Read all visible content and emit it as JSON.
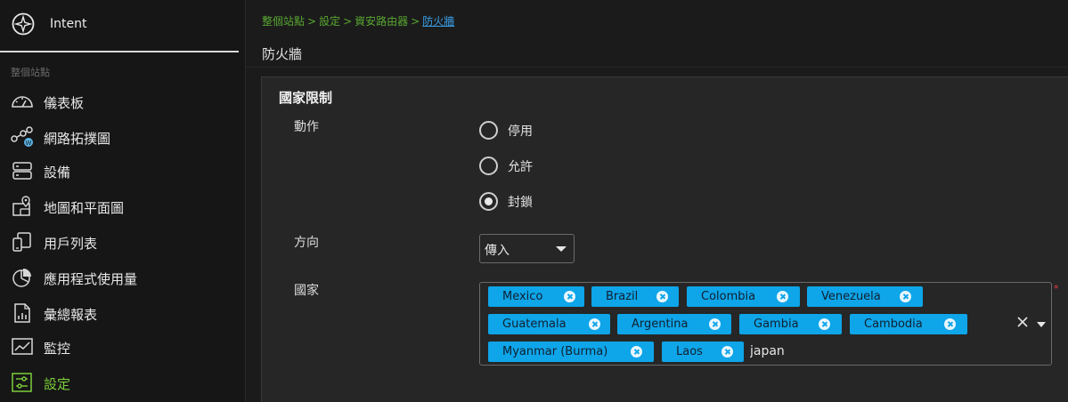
{
  "sidebar": {
    "brand_label": "Intent",
    "section_label": "整個站點",
    "items": [
      {
        "label": "儀表板",
        "icon": "dashboard-icon"
      },
      {
        "label": "網路拓撲圖",
        "icon": "topology-icon"
      },
      {
        "label": "設備",
        "icon": "devices-icon"
      },
      {
        "label": "地圖和平面圖",
        "icon": "map-icon"
      },
      {
        "label": "用戶列表",
        "icon": "clients-icon"
      },
      {
        "label": "應用程式使用量",
        "icon": "pie-chart-icon"
      },
      {
        "label": "彙總報表",
        "icon": "report-icon"
      },
      {
        "label": "監控",
        "icon": "monitor-icon"
      },
      {
        "label": "設定",
        "icon": "settings-icon",
        "active": true
      }
    ]
  },
  "breadcrumb": {
    "items": [
      "整個站點",
      "設定",
      "資安路由器"
    ],
    "separator": ">",
    "current": "防火牆"
  },
  "page": {
    "title": "防火牆"
  },
  "panel": {
    "title": "國家限制",
    "action": {
      "label": "動作",
      "options": [
        {
          "label": "停用",
          "checked": false
        },
        {
          "label": "允許",
          "checked": false
        },
        {
          "label": "封鎖",
          "checked": true
        }
      ]
    },
    "direction": {
      "label": "方向",
      "value": "傳入"
    },
    "country": {
      "label": "國家",
      "required_mark": "*",
      "selected": [
        "Mexico",
        "Brazil",
        "Colombia",
        "Venezuela",
        "Guatemala",
        "Argentina",
        "Gambia",
        "Cambodia",
        "Myanmar (Burma)",
        "Laos"
      ],
      "input_value": "japan"
    }
  },
  "colors": {
    "accent_green": "#7ccf3a",
    "breadcrumb_green": "#5aa832",
    "link_blue": "#3aa0e8",
    "chip_blue": "#0ea5e9",
    "required_red": "#e04040"
  }
}
